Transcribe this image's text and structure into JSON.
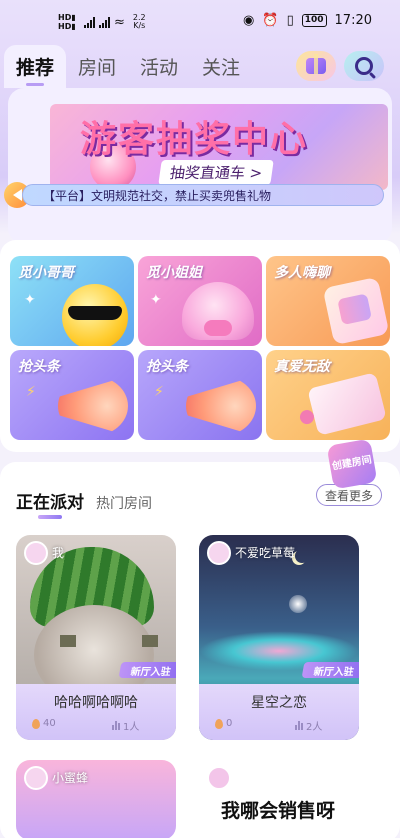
{
  "status_bar": {
    "sim1": "HD",
    "sim2": "HD",
    "speed_value": "2.2",
    "speed_unit": "K/s",
    "battery": "100",
    "time": "17:20"
  },
  "header": {
    "tabs": [
      {
        "label": "推荐",
        "active": true
      },
      {
        "label": "房间",
        "active": false
      },
      {
        "label": "活动",
        "active": false
      },
      {
        "label": "关注",
        "active": false
      }
    ]
  },
  "banner": {
    "title": "游客抽奖中心",
    "subtitle": "抽奖直通车 >"
  },
  "notice": {
    "text": "【平台】文明规范社交，禁止买卖兜售礼物"
  },
  "categories": [
    {
      "label": "觅小哥哥"
    },
    {
      "label": "觅小姐姐"
    },
    {
      "label": "多人嗨聊"
    },
    {
      "label": "抢头条"
    },
    {
      "label": "抢头条"
    },
    {
      "label": "真爱无敌"
    }
  ],
  "party": {
    "create_button": "创建房间",
    "tabs": [
      {
        "label": "正在派对",
        "active": true
      },
      {
        "label": "热门房间",
        "active": false
      }
    ],
    "more_button": "查看更多",
    "rooms": [
      {
        "owner": "我",
        "tag": "新厅入驻",
        "name": "哈哈啊哈啊哈",
        "heat": "40",
        "users": "1人"
      },
      {
        "owner": "不爱吃草莓",
        "tag": "新厅入驻",
        "name": "星空之恋",
        "heat": "0",
        "users": "2人"
      },
      {
        "owner": "小蜜蜂",
        "name": ""
      },
      {
        "owner": "",
        "name": "我哪会销售呀"
      }
    ]
  },
  "colors": {
    "accent": "#8f78f2",
    "header_bg": "#e6dcfb",
    "tag_bg": "#bd94f7"
  }
}
